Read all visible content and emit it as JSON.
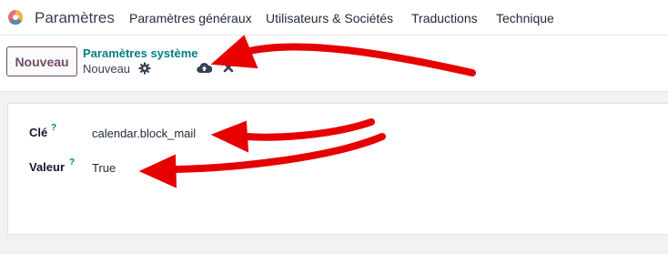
{
  "navbar": {
    "app_name": "Paramètres",
    "menu": [
      "Paramètres généraux",
      "Utilisateurs & Sociétés",
      "Traductions",
      "Technique"
    ]
  },
  "controlbar": {
    "new_label": "Nouveau",
    "breadcrumb_parent": "Paramètres système",
    "breadcrumb_current": "Nouveau"
  },
  "form": {
    "key_label": "Clé",
    "key_help": "?",
    "key_value": "calendar.block_mail",
    "value_label": "Valeur",
    "value_help": "?",
    "value_value": "True"
  },
  "colors": {
    "brand": "#714b67",
    "accent": "#017e84",
    "annotation": "#e60000"
  },
  "icons": {
    "logo": "odoo-logo-icon",
    "settings": "gear-icon",
    "save": "cloud-upload-icon",
    "discard": "close-icon"
  }
}
